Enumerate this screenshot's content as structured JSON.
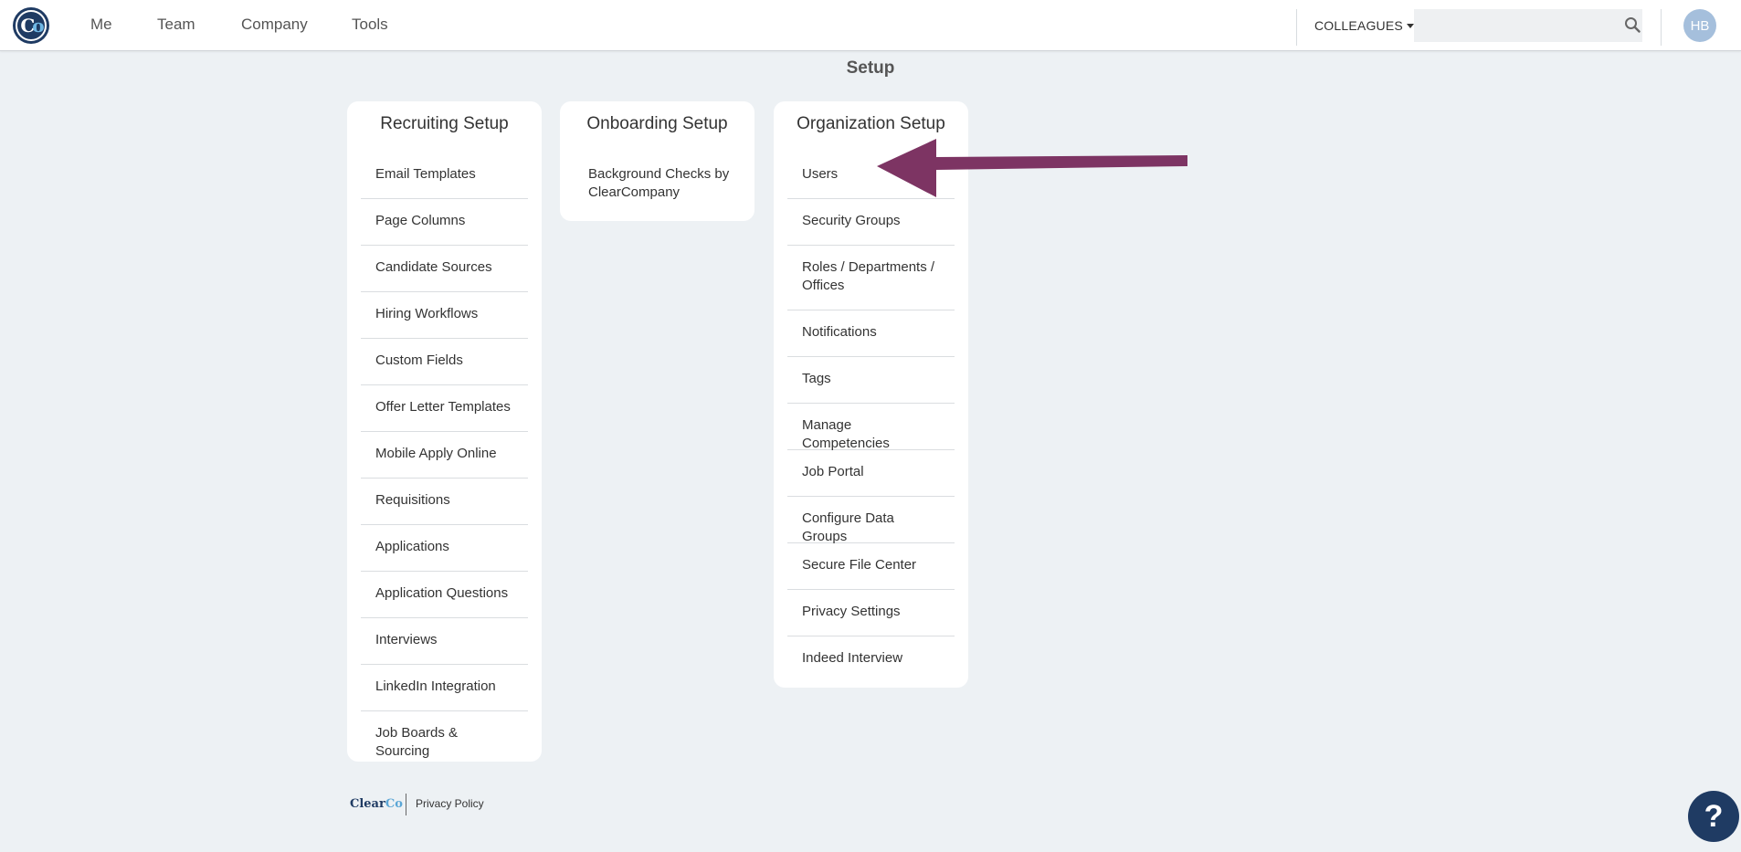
{
  "topnav": {
    "logo_alt": "CO",
    "links": [
      "Me",
      "Team",
      "Company",
      "Tools"
    ],
    "colleagues_label": "COLLEAGUES",
    "search": {
      "placeholder": "",
      "value": ""
    },
    "avatar_initials": "HB"
  },
  "page": {
    "title": "Setup"
  },
  "cards": {
    "recruiting": {
      "title": "Recruiting Setup",
      "items": [
        "Email Templates",
        "Page Columns",
        "Candidate Sources",
        "Hiring Workflows",
        "Custom Fields",
        "Offer Letter Templates",
        "Mobile Apply Online",
        "Requisitions",
        "Applications",
        "Application Questions",
        "Interviews",
        "LinkedIn Integration",
        "Job Boards & Sourcing"
      ]
    },
    "onboarding": {
      "title": "Onboarding Setup",
      "items": [
        "Background Checks by ClearCompany"
      ]
    },
    "organization": {
      "title": "Organization Setup",
      "items": [
        "Users",
        "Security Groups",
        "Roles / Departments / Offices",
        "Notifications",
        "Tags",
        "Manage Competencies",
        "Job Portal",
        "Configure Data Groups",
        "Secure File Center",
        "Privacy Settings",
        "Indeed Interview"
      ]
    }
  },
  "footer": {
    "logo_text_a": "Clear",
    "logo_text_b": "Co",
    "privacy_link": "Privacy Policy"
  },
  "help": {
    "label": "?"
  },
  "colors": {
    "brand_navy": "#1f3b63",
    "brand_blue": "#6fb7e4",
    "annotation_arrow": "#7d3463",
    "page_bg": "#edf1f4"
  }
}
